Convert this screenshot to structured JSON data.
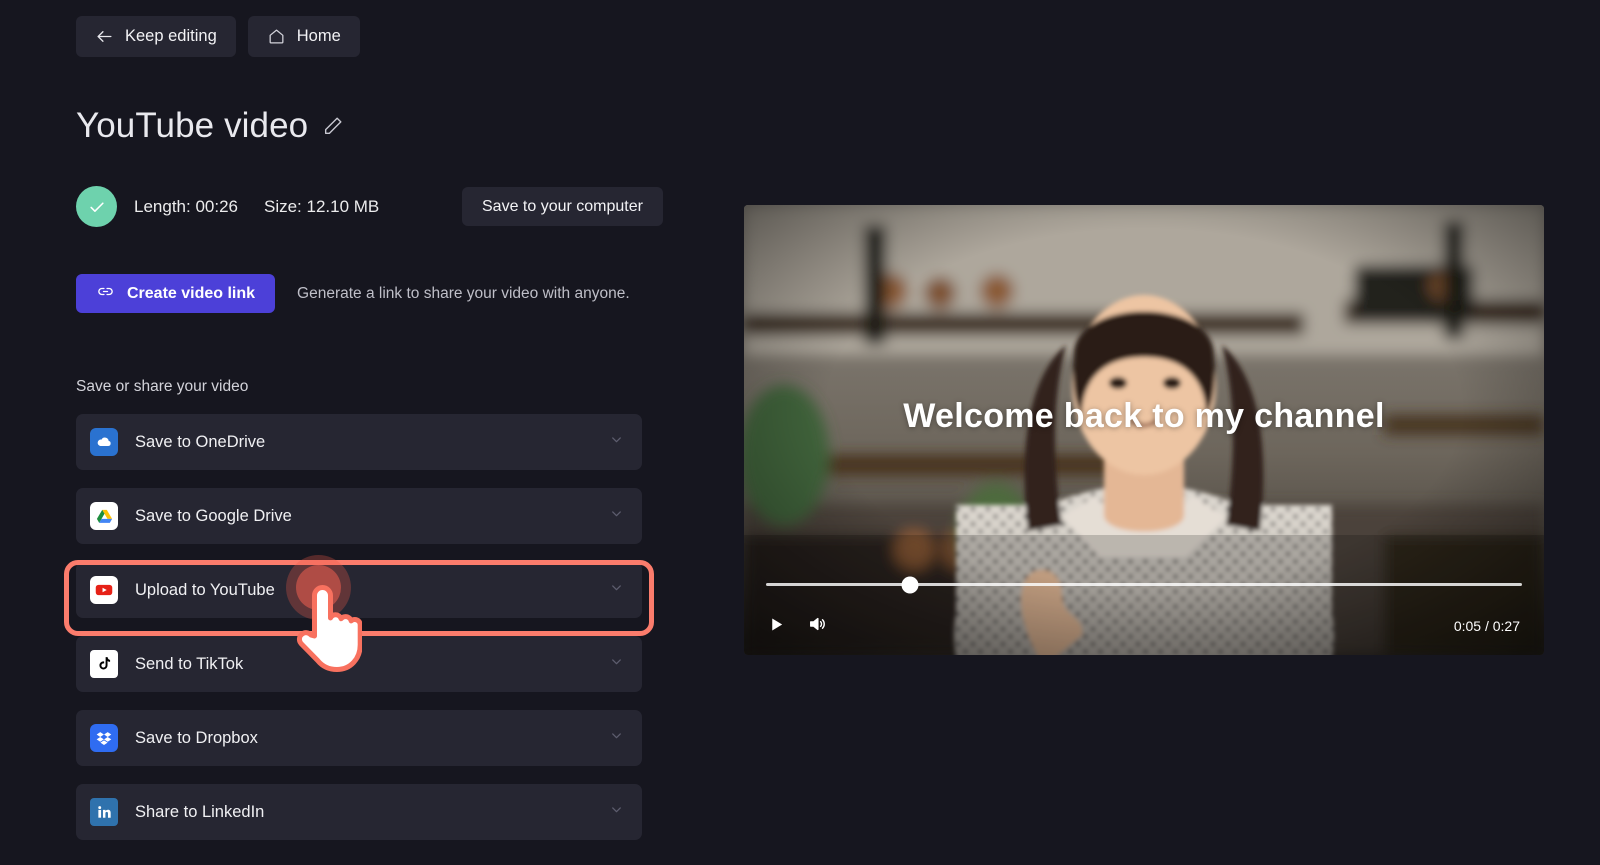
{
  "topbar": {
    "back_label": "Keep editing",
    "back_icon": "arrow-left-icon",
    "home_label": "Home",
    "home_icon": "home-icon"
  },
  "header": {
    "title": "YouTube video",
    "edit_icon": "pencil-icon",
    "status_icon": "check-circle-icon",
    "length": "Length: 00:26",
    "size": "Size: 12.10 MB",
    "save_computer_label": "Save to your computer"
  },
  "link_section": {
    "create_link_label": "Create video link",
    "link_icon": "link-icon",
    "hint": "Generate a link to share your video with anyone."
  },
  "share": {
    "section_label": "Save or share your video",
    "chevron_icon": "chevron-down-icon",
    "items": [
      {
        "label": "Save to OneDrive",
        "icon": "onedrive-icon"
      },
      {
        "label": "Save to Google Drive",
        "icon": "google-drive-icon"
      },
      {
        "label": "Upload to YouTube",
        "icon": "youtube-icon"
      },
      {
        "label": "Send to TikTok",
        "icon": "tiktok-icon"
      },
      {
        "label": "Save to Dropbox",
        "icon": "dropbox-icon"
      },
      {
        "label": "Share to LinkedIn",
        "icon": "linkedin-icon"
      }
    ]
  },
  "annotation": {
    "highlighted_item": "Upload to YouTube",
    "highlight_color": "#fb7c6c",
    "cursor_icon": "hand-pointer-cursor"
  },
  "player": {
    "caption": "Welcome back to my channel",
    "play_icon": "play-icon",
    "volume_icon": "volume-icon",
    "timecode": "0:05 / 0:27",
    "progress_percent": 19
  },
  "colors": {
    "background": "#16161f",
    "card": "#262632",
    "accent_purple": "#4c40d8",
    "status_green": "#6ed2ad",
    "highlight_red": "#fb7c6c"
  }
}
